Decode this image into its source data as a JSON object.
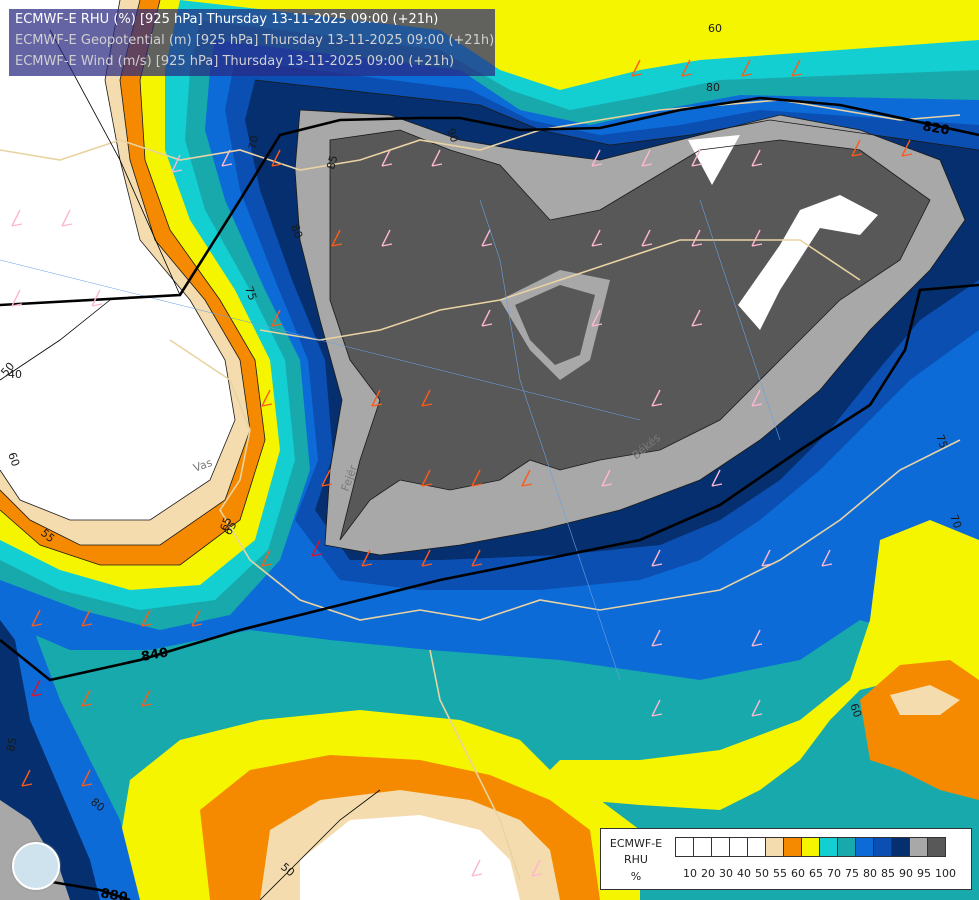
{
  "header": {
    "line1": "ECMWF-E RHU (%) [925 hPa] Thursday 13-11-2025 09:00 (+21h)",
    "line2": "ECMWF-E Geopotential (m) [925 hPa] Thursday 13-11-2025 09:00 (+21h)",
    "line3": "ECMWF-E Wind (m/s) [925 hPa] Thursday 13-11-2025 09:00 (+21h)"
  },
  "legend": {
    "title1": "ECMWF-E",
    "title2": "RHU",
    "title3": "%",
    "ticks": [
      "10",
      "20",
      "30",
      "40",
      "50",
      "55",
      "60",
      "65",
      "70",
      "75",
      "80",
      "85",
      "90",
      "95",
      "100"
    ],
    "colors": [
      "#ffffff",
      "#ffffff",
      "#ffffff",
      "#ffffff",
      "#ffffff",
      "#f5dcae",
      "#f58a00",
      "#f5f500",
      "#14cfd2",
      "#18a9ad",
      "#0d6bd8",
      "#0b4fb3",
      "#052f6e",
      "#a8a8a8",
      "#585858"
    ]
  },
  "geopotential_labels": [
    "820",
    "840",
    "880"
  ],
  "rhu_labels": [
    "60",
    "80",
    "85",
    "80",
    "75",
    "70",
    "65",
    "60",
    "55",
    "50",
    "40",
    "90",
    "85",
    "80",
    "75",
    "70",
    "65",
    "60",
    "50"
  ],
  "place_labels": [
    "Vas",
    "Fejér",
    "Békés"
  ]
}
